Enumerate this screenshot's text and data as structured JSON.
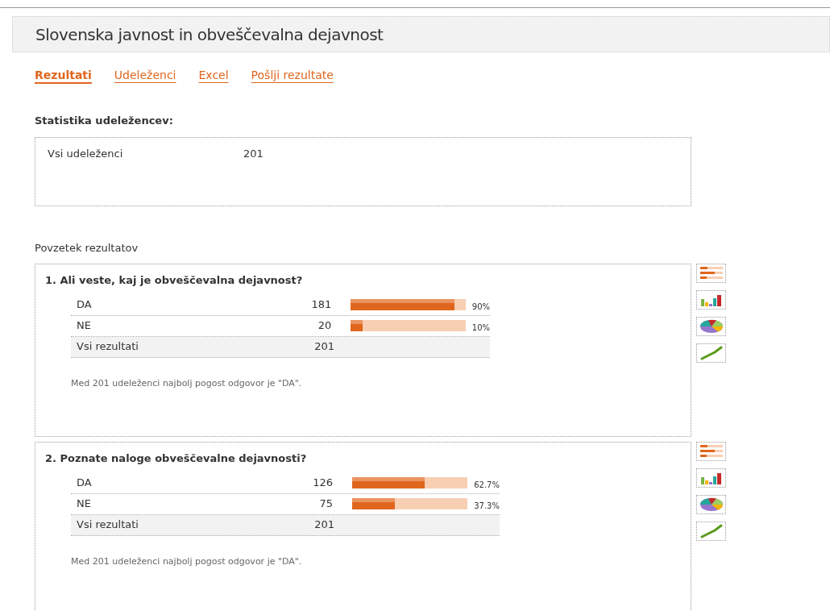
{
  "title": "Slovenska javnost in obveščevalna dejavnost",
  "tabs": [
    {
      "label": "Rezultati",
      "selected": true
    },
    {
      "label": "Udeleženci",
      "selected": false
    },
    {
      "label": "Excel",
      "selected": false
    },
    {
      "label": "Pošlji rezultate",
      "selected": false
    }
  ],
  "stats": {
    "heading": "Statistika udeležencev:",
    "rows": [
      {
        "label": "Vsi udeleženci",
        "value": "201"
      }
    ]
  },
  "summary_heading": "Povzetek rezultatov",
  "questions": [
    {
      "title": "1. Ali veste, kaj je obveščevalna dejavnost?",
      "answers": [
        {
          "label": "DA",
          "count": "181",
          "level": 0.9,
          "percent": "90%"
        },
        {
          "label": "NE",
          "count": "20",
          "level": 0.1,
          "percent": "10%"
        }
      ],
      "total_label": "Vsi rezultati",
      "total": "201",
      "note": "Med 201 udeleženci najbolj pogost odgovor je \"DA\"."
    },
    {
      "title": "2. Poznate naloge obveščevalne dejavnosti?",
      "answers": [
        {
          "label": "DA",
          "count": "126",
          "level": 0.627,
          "percent": "62.7%"
        },
        {
          "label": "NE",
          "count": "75",
          "level": 0.373,
          "percent": "37.3%"
        }
      ],
      "total_label": "Vsi rezultati",
      "total": "201",
      "note": "Med 201 udeleženci najbolj pogost odgovor je \"DA\"."
    }
  ]
}
